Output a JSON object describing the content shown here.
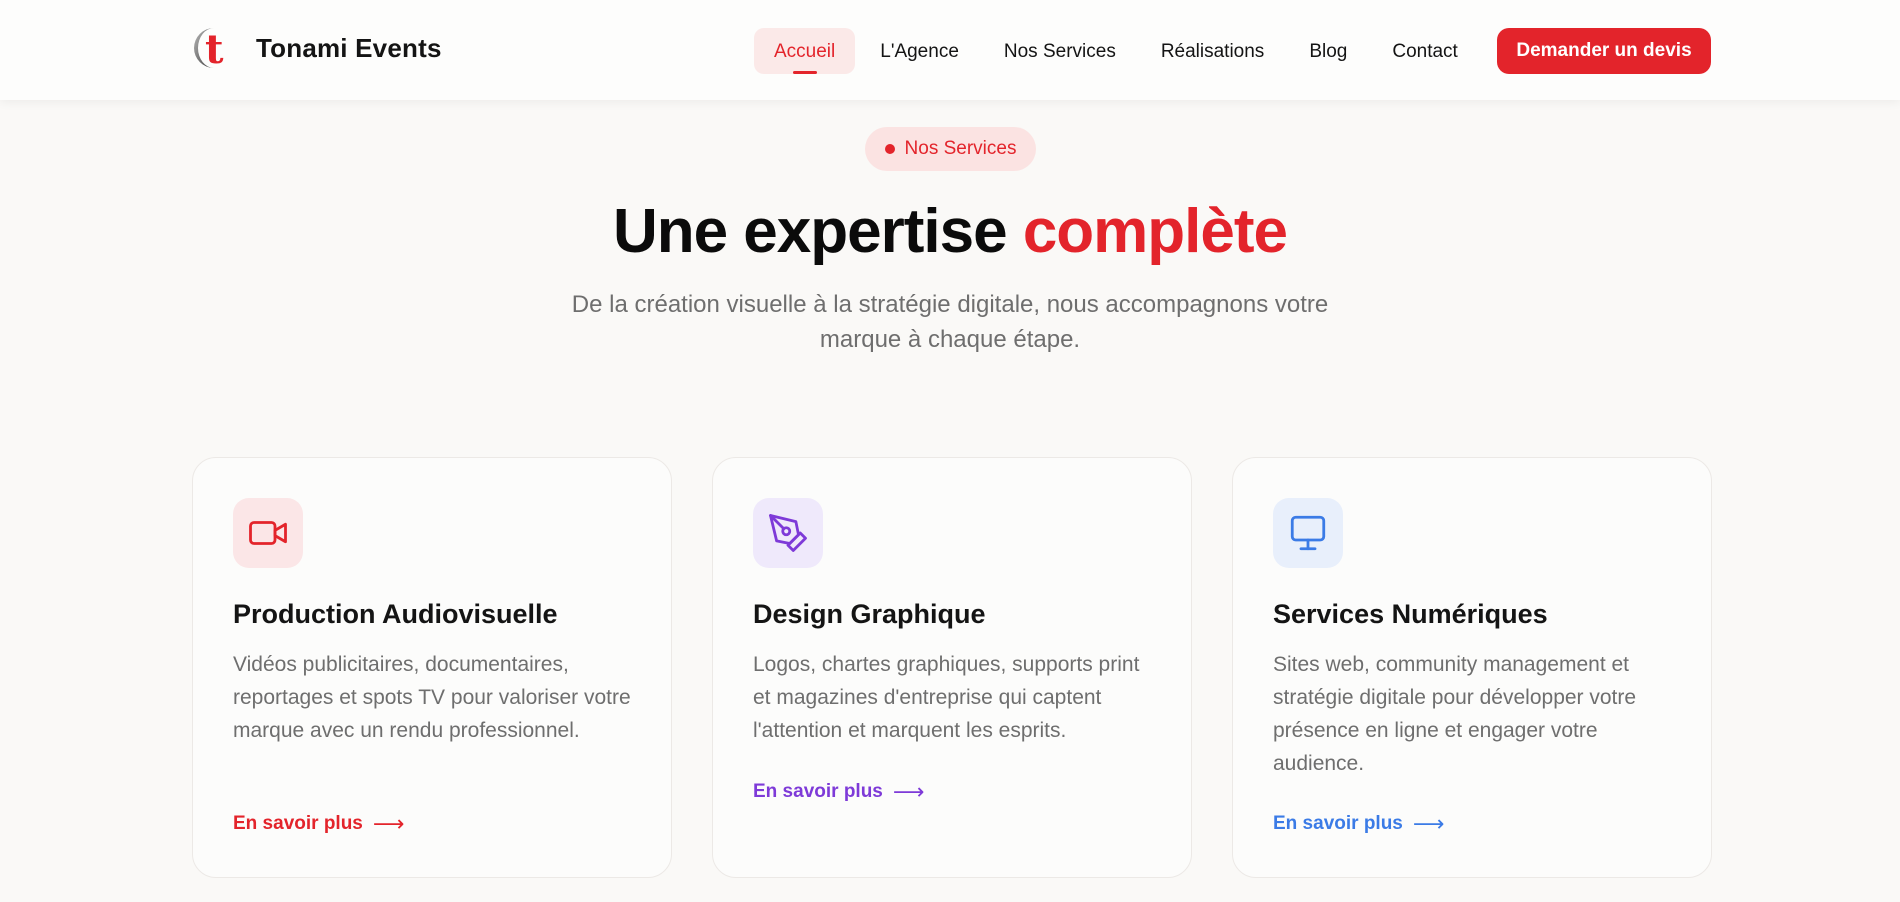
{
  "brand": {
    "name": "Tonami Events",
    "logo_letter": "t",
    "accent_color": "#e3242b"
  },
  "nav": {
    "items": [
      {
        "label": "Accueil",
        "active": true
      },
      {
        "label": "L'Agence",
        "active": false
      },
      {
        "label": "Nos Services",
        "active": false
      },
      {
        "label": "Réalisations",
        "active": false
      },
      {
        "label": "Blog",
        "active": false
      },
      {
        "label": "Contact",
        "active": false
      }
    ],
    "cta_label": "Demander un devis"
  },
  "hero": {
    "badge": "Nos Services",
    "title_part1": "Une expertise",
    "title_accent": "complète",
    "subtitle": "De la création visuelle à la stratégie digitale, nous accompagnons votre marque à chaque étape."
  },
  "services": [
    {
      "icon": "video-camera-icon",
      "color": "#e3242b",
      "icon_bg": "#fbe6e7",
      "title": "Production Audiovisuelle",
      "description": "Vidéos publicitaires, documentaires, reportages et spots TV pour valoriser votre marque avec un rendu professionnel.",
      "link": "En savoir plus",
      "arrow": "⟶"
    },
    {
      "icon": "pen-tool-icon",
      "color": "#7e3ad8",
      "icon_bg": "#efe9fb",
      "title": "Design Graphique",
      "description": "Logos, chartes graphiques, supports print et magazines d'entreprise qui captent l'attention et marquent les esprits.",
      "link": "En savoir plus",
      "arrow": "⟶"
    },
    {
      "icon": "monitor-icon",
      "color": "#3b7be6",
      "icon_bg": "#e8effb",
      "title": "Services Numériques",
      "description": "Sites web, community management et stratégie digitale pour développer votre présence en ligne et engager votre audience.",
      "link": "En savoir plus",
      "arrow": "⟶"
    }
  ]
}
